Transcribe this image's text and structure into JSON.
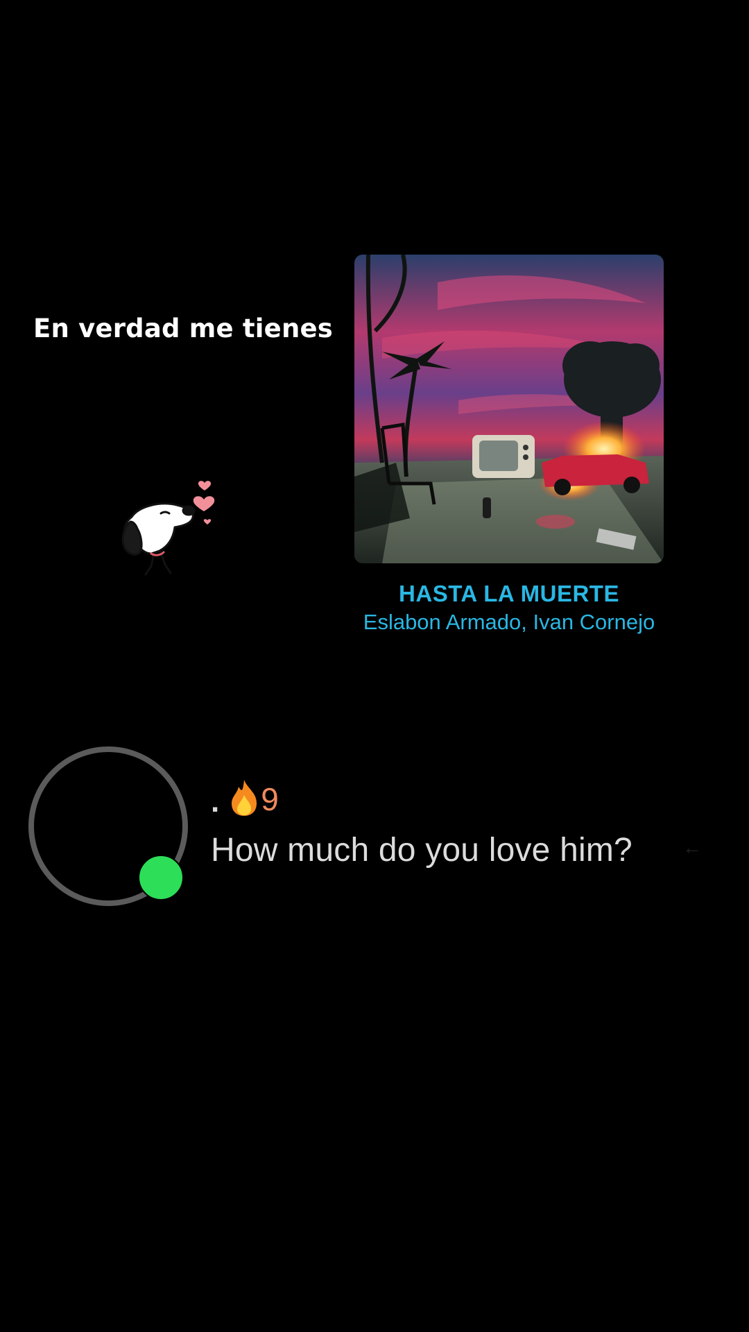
{
  "lyric_text": "En verdad me tienes",
  "song": {
    "title": "HASTA LA MUERTE",
    "artist": "Eslabon Armado, Ivan Cornejo"
  },
  "chat": {
    "username": ".",
    "streak_icon": "fire-icon",
    "streak_count": "9",
    "message": "How much do you love him?",
    "status": "online"
  },
  "colors": {
    "background": "#000000",
    "song_text": "#2ab7e3",
    "online_dot": "#2cde58",
    "streak_number": "#f08a5d",
    "heart": "#f2909a"
  }
}
